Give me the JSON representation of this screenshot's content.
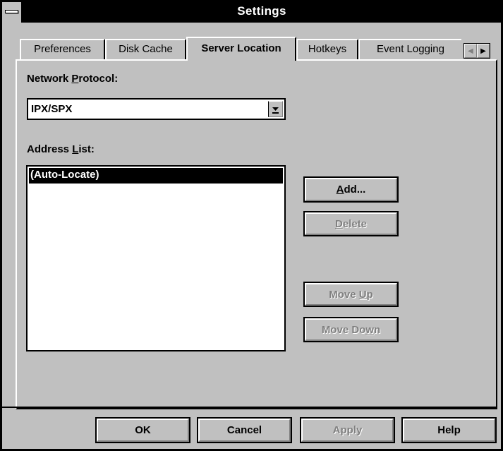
{
  "window": {
    "title": "Settings"
  },
  "tabs": [
    {
      "label": "Preferences",
      "active": false
    },
    {
      "label": "Disk Cache",
      "active": false
    },
    {
      "label": "Server Location",
      "active": true
    },
    {
      "label": "Hotkeys",
      "active": false
    },
    {
      "label": "Event Logging",
      "active": false
    }
  ],
  "network_protocol": {
    "label_pre": "Network ",
    "label_key": "P",
    "label_post": "rotocol:",
    "value": "IPX/SPX"
  },
  "address_list": {
    "label_pre": "Address ",
    "label_key": "L",
    "label_post": "ist:",
    "items": [
      "(Auto-Locate)"
    ],
    "selected_index": 0
  },
  "side_buttons": {
    "add": {
      "key": "A",
      "rest": "dd...",
      "enabled": true
    },
    "delete": {
      "key": "D",
      "rest": "elete",
      "enabled": false
    },
    "move_up": {
      "pre": "Move ",
      "key": "U",
      "rest": "p",
      "enabled": false
    },
    "move_down": {
      "pre": "Move Do",
      "key": "w",
      "rest": "n",
      "enabled": false
    }
  },
  "footer": {
    "ok": "OK",
    "cancel": "Cancel",
    "apply": "Apply",
    "help": "Help"
  }
}
